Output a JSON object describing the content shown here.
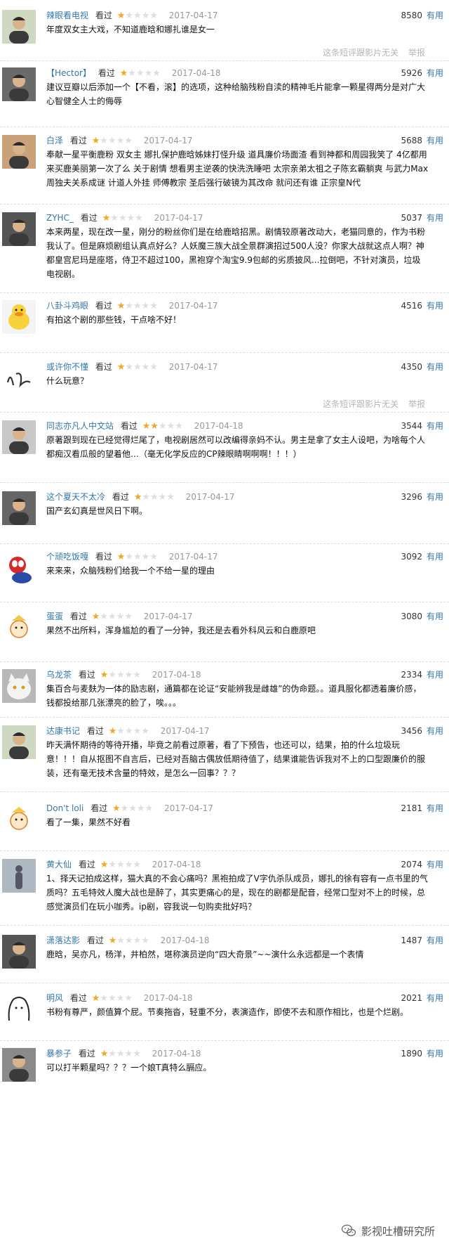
{
  "colors": {
    "name": "#3377aa",
    "star_on": "#f5a623",
    "star_off": "#dedede",
    "meta": "#999999",
    "report": "#b5b5b5"
  },
  "report": {
    "text": "这条短评跟影片无关",
    "link": "举报"
  },
  "watermark": {
    "icon": "wechat-icon",
    "text": "影视吐槽研究所"
  },
  "reviews": [
    {
      "name": "辣眼看电视",
      "action": "看过",
      "rating": 1,
      "date": "2017-04-17",
      "votes": "8580",
      "useful": "有用",
      "text": "年度双女主大戏，不知道鹿晗和娜扎谁是女一",
      "show_report": true,
      "avatar_icon": "portrait-avatar"
    },
    {
      "name": "【Hector】",
      "action": "看过",
      "rating": 1,
      "date": "2017-04-18",
      "votes": "5926",
      "useful": "有用",
      "text": "建议豆瓣以后添加一个【不看，滚】的选项，这种给脑残粉自渎的精神毛片能拿一颗星得两分是对广大心智健全人士的侮辱",
      "show_report": false,
      "avatar_icon": "portrait-avatar"
    },
    {
      "name": "白泽",
      "action": "看过",
      "rating": 1,
      "date": "2017-04-17",
      "votes": "5688",
      "useful": "有用",
      "text": "奉献一星平衡鹿粉 双女主 娜扎保护鹿晗姊妹打怪升级 道具廉价场面渣 看到神都和周园我笑了 4亿都用来买鹿美丽第一次了么 关于剧情 想看男主逆袭的快洗洗睡吧 太宗亲弟太祖之子陈玄霸躺爽 与武力Max周独夫关系成谜 计道人外挂 师傅教宗 圣后强行破镜为其改命 就问还有谁 正宗皇N代",
      "show_report": false,
      "avatar_icon": "portrait-avatar"
    },
    {
      "name": "ZYHC_",
      "action": "看过",
      "rating": 1,
      "date": "2017-04-17",
      "votes": "5037",
      "useful": "有用",
      "text": "本来两星，现在改一星，刚分的粉丝你们是在给鹿晗招黑。剧情较原著改动大，老猫同意的，作为书粉我认了。但是麻烦剧组认真点好么？人妖魔三族大战全景群演招过500人没？你家大战就这点人啊？神都皇宫尼玛是座塔，侍卫不超过100，黑袍穿个淘宝9.9包邮的劣质披风...拉倒吧，不针对演员，垃圾电视剧。",
      "show_report": false,
      "avatar_icon": "portrait-avatar"
    },
    {
      "name": "八卦斗鸡眼",
      "action": "看过",
      "rating": 1,
      "date": "2017-04-17",
      "votes": "4516",
      "useful": "有用",
      "text": "有拍这个剧的那些钱，干点啥不好！",
      "show_report": false,
      "avatar_icon": "duck-avatar"
    },
    {
      "name": "或许你不懂",
      "action": "看过",
      "rating": 1,
      "date": "2017-04-17",
      "votes": "4350",
      "useful": "有用",
      "text": "什么玩意？",
      "show_report": true,
      "avatar_icon": "calligraphy-avatar"
    },
    {
      "name": "同志亦凡人中文站",
      "action": "看过",
      "rating": 2,
      "date": "2017-04-18",
      "votes": "3544",
      "useful": "有用",
      "text": "原著跟到现在已经觉得烂尾了，电视剧居然可以改编得亲妈不认。男主是拿了女主人设吧，为啥每个人都痴汉看瓜般的望着他…（毫无化学反应的CP辣眼睛啊啊啊！！！）",
      "show_report": false,
      "avatar_icon": "portrait-avatar"
    },
    {
      "name": "这个夏天不太冷",
      "action": "看过",
      "rating": 1,
      "date": "2017-04-17",
      "votes": "3296",
      "useful": "有用",
      "text": "国产玄幻真是世风日下啊。",
      "show_report": false,
      "avatar_icon": "portrait-avatar"
    },
    {
      "name": "个顽吃饭嘎",
      "action": "看过",
      "rating": 1,
      "date": "2017-04-17",
      "votes": "3092",
      "useful": "有用",
      "text": "来来来，众脑残粉们给我一个不给一星的理由",
      "show_report": false,
      "avatar_icon": "toy-avatar"
    },
    {
      "name": "蛋蛋",
      "action": "看过",
      "rating": 1,
      "date": "2017-04-17",
      "votes": "3080",
      "useful": "有用",
      "text": "果然不出所料，浑身尴尬的看了一分钟，我还是去看外科风云和白鹿原吧",
      "show_report": false,
      "avatar_icon": "cartoon-avatar"
    },
    {
      "name": "乌龙茶",
      "action": "看过",
      "rating": 1,
      "date": "2017-04-18",
      "votes": "2334",
      "useful": "有用",
      "text": "集百合与麦麸为一体的励志剧，通篇都在论证“安能辨我是雌雄”的伪命题。。道具服化都透着廉价感，钱都投给那几张漂亮的脸了，唉。。。",
      "show_report": false,
      "avatar_icon": "cat-avatar"
    },
    {
      "name": "达康书记",
      "action": "看过",
      "rating": 1,
      "date": "2017-04-17",
      "votes": "3456",
      "useful": "有用",
      "text": "昨天满怀期待的等待开播，毕竟之前看过原著，看了下预告，也还可以，结果，拍的什么垃圾玩意！！！自从抠图不自言后，已经对吾脑古偶放低期待值了，结果谁能告诉我对不上的口型跟廉价的服装，还有毫无技术含量的特效，是怎么一回事？？？",
      "show_report": false,
      "avatar_icon": "portrait-avatar"
    },
    {
      "name": "Don't loli",
      "action": "看过",
      "rating": 1,
      "date": "2017-04-17",
      "votes": "2181",
      "useful": "有用",
      "text": "看了一集，果然不好看",
      "show_report": false,
      "avatar_icon": "cartoon-avatar"
    },
    {
      "name": "黄大仙",
      "action": "看过",
      "rating": 1,
      "date": "2017-04-18",
      "votes": "2074",
      "useful": "有用",
      "text": "1、择天记拍成这样，猫大真的不会心痛吗？黑袍拍成了V字仇杀队成员，娜扎的徐有容有一点书里的气质吗？五毛特效人魔大战也是醉了，其实更痛心的是，现在的剧都是配音，经常口型对不上的时候，总感觉演员们在玩小咖秀。ip剧，容我说一句购卖批好吗？",
      "show_report": false,
      "avatar_icon": "silhouette-avatar"
    },
    {
      "name": "潇落达影",
      "action": "看过",
      "rating": 1,
      "date": "2017-04-18",
      "votes": "1487",
      "useful": "有用",
      "text": "鹿晗，吴亦凡，杨洋，井柏然，堪称演员逆向“四大奇景”~~演什么永远都是一个表情",
      "show_report": false,
      "avatar_icon": "portrait-avatar"
    },
    {
      "name": "明风",
      "action": "看过",
      "rating": 1,
      "date": "2017-04-18",
      "votes": "2021",
      "useful": "有用",
      "text": "书粉有尊严，颜值算个屁。节奏拖沓，轻重不分，表演造作，即使不去和原作相比，也是个烂剧。",
      "show_report": false,
      "avatar_icon": "sketch-avatar"
    },
    {
      "name": "暴参子",
      "action": "看过",
      "rating": 1,
      "date": "2017-04-18",
      "votes": "1890",
      "useful": "有用",
      "text": "可以打半颗星吗？？？一个娘T真特么膈应。",
      "show_report": false,
      "avatar_icon": "portrait-avatar"
    }
  ]
}
